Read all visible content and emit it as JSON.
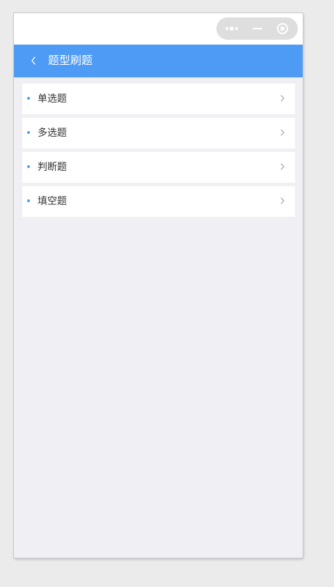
{
  "header": {
    "title": "题型刷题",
    "back_icon": "chevron-left-icon"
  },
  "capsule": {
    "more_icon": "more-dots-icon",
    "minimize_icon": "minimize-icon",
    "close_icon": "close-target-icon"
  },
  "colors": {
    "accent": "#4d9bf5",
    "background": "#f0f0f4",
    "item_background": "#ffffff",
    "text": "#333333"
  },
  "question_types": [
    {
      "label": "单选题",
      "icon": "chevron-right-icon"
    },
    {
      "label": "多选题",
      "icon": "chevron-right-icon"
    },
    {
      "label": "判断题",
      "icon": "chevron-right-icon"
    },
    {
      "label": "填空题",
      "icon": "chevron-right-icon"
    }
  ]
}
